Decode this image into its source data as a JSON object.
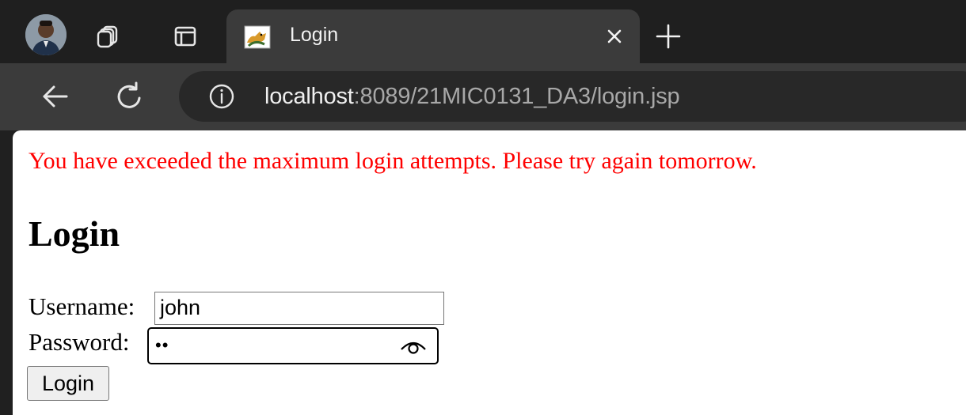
{
  "browser": {
    "tab": {
      "title": "Login",
      "favicon": "tomcat-icon",
      "close_icon": "close-icon"
    },
    "new_tab_icon": "plus-icon",
    "address_bar": {
      "host": "localhost",
      "rest": ":8089/21MIC0131_DA3/login.jsp"
    },
    "icons": [
      "profile-avatar",
      "workspaces-icon",
      "tab-actions-icon",
      "back-arrow-icon",
      "reload-icon",
      "info-icon"
    ]
  },
  "page": {
    "error_message": "You have exceeded the maximum login attempts. Please try again tomorrow.",
    "heading": "Login",
    "username_label": "Username:",
    "username_value": "john",
    "password_label": "Password:",
    "password_mask": "••",
    "login_button": "Login"
  },
  "colors": {
    "error": "#ff0000",
    "chrome_dark": "#1f1f1f",
    "chrome_mid": "#3b3b3b",
    "omnibox": "#282828"
  }
}
